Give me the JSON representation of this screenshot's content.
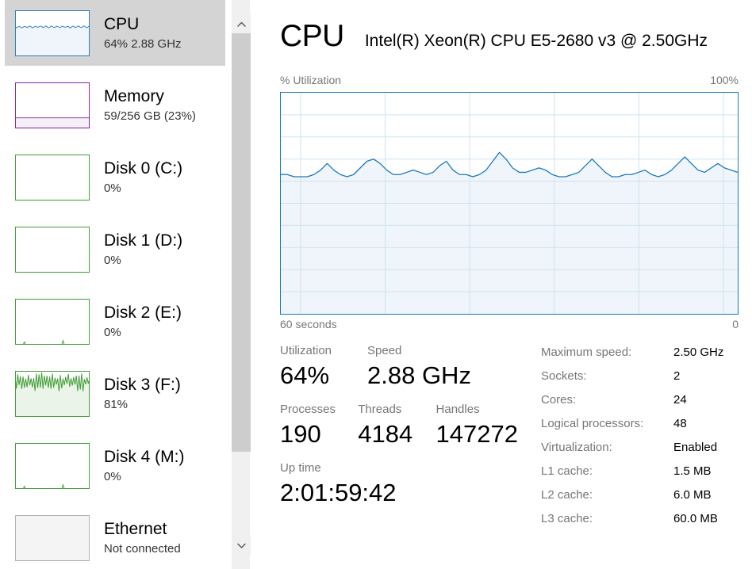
{
  "sidebar": {
    "items": [
      {
        "name": "CPU",
        "title": "CPU",
        "subtitle": "64%  2.88 GHz",
        "selected": true,
        "color": "#2a7ab5",
        "fill": "#eff5fa",
        "level": 64,
        "graph_style": "wavy"
      },
      {
        "name": "Memory",
        "title": "Memory",
        "subtitle": "59/256 GB (23%)",
        "selected": false,
        "color": "#8b1fa9",
        "fill": "#f5eff7",
        "level": 23,
        "graph_style": "flat"
      },
      {
        "name": "Disk 0 (C:)",
        "title": "Disk 0 (C:)",
        "subtitle": "0%",
        "selected": false,
        "color": "#3f9c35",
        "fill": "#eef6ed",
        "level": 1,
        "graph_style": "idle"
      },
      {
        "name": "Disk 1 (D:)",
        "title": "Disk 1 (D:)",
        "subtitle": "0%",
        "selected": false,
        "color": "#3f9c35",
        "fill": "#eef6ed",
        "level": 1,
        "graph_style": "idle"
      },
      {
        "name": "Disk 2 (E:)",
        "title": "Disk 2 (E:)",
        "subtitle": "0%",
        "selected": false,
        "color": "#3f9c35",
        "fill": "#eef6ed",
        "level": 0,
        "graph_style": "idle"
      },
      {
        "name": "Disk 3 (F:)",
        "title": "Disk 3 (F:)",
        "subtitle": "81%",
        "selected": false,
        "color": "#3f9c35",
        "fill": "#eaf4e8",
        "level": 81,
        "graph_style": "noisy"
      },
      {
        "name": "Disk 4 (M:)",
        "title": "Disk 4 (M:)",
        "subtitle": "0%",
        "selected": false,
        "color": "#3f9c35",
        "fill": "#eef6ed",
        "level": 0,
        "graph_style": "idle"
      },
      {
        "name": "Ethernet",
        "title": "Ethernet",
        "subtitle": "Not connected",
        "selected": false,
        "color": "#b0b0b0",
        "fill": "#f4f4f4",
        "level": 0,
        "graph_style": "disabled"
      }
    ]
  },
  "scrollbar": {
    "up_arrow": "chevron-up-icon",
    "down_arrow": "chevron-down-icon"
  },
  "header": {
    "title": "CPU",
    "model": "Intel(R) Xeon(R) CPU E5-2680 v3 @ 2.50GHz"
  },
  "graph": {
    "axis_top_left": "% Utilization",
    "axis_top_right": "100%",
    "axis_bottom_left": "60 seconds",
    "axis_bottom_right": "0",
    "line_color": "#1a7aba",
    "fill_color": "#eff5fa",
    "grid_color": "#cfe3f0",
    "border_color": "#157ab5"
  },
  "chart_data": {
    "type": "area",
    "title": "% Utilization",
    "xlabel": "60 seconds",
    "ylabel": "% Utilization",
    "ylim": [
      0,
      100
    ],
    "xlim": [
      60,
      0
    ],
    "grid": true,
    "grid_rows": 10,
    "grid_cols": 6,
    "series": [
      {
        "name": "CPU utilization",
        "values": [
          63,
          63,
          62,
          62,
          62,
          63,
          65,
          68,
          65,
          63,
          62,
          63,
          66,
          69,
          70,
          68,
          65,
          63,
          63,
          64,
          65,
          64,
          63,
          64,
          67,
          69,
          65,
          63,
          63,
          62,
          63,
          65,
          69,
          73,
          70,
          66,
          64,
          64,
          65,
          66,
          65,
          63,
          62,
          62,
          63,
          64,
          67,
          70,
          67,
          64,
          62,
          62,
          63,
          63,
          64,
          65,
          63,
          62,
          63,
          65,
          68,
          71,
          68,
          65,
          64,
          66,
          68,
          66,
          65,
          64
        ]
      }
    ]
  },
  "stats": {
    "utilization": {
      "label": "Utilization",
      "value": "64%"
    },
    "speed": {
      "label": "Speed",
      "value": "2.88 GHz"
    },
    "processes": {
      "label": "Processes",
      "value": "190"
    },
    "threads": {
      "label": "Threads",
      "value": "4184"
    },
    "handles": {
      "label": "Handles",
      "value": "147272"
    },
    "uptime": {
      "label": "Up time",
      "value": "2:01:59:42"
    }
  },
  "specs": [
    {
      "key": "Maximum speed:",
      "value": "2.50 GHz"
    },
    {
      "key": "Sockets:",
      "value": "2"
    },
    {
      "key": "Cores:",
      "value": "24"
    },
    {
      "key": "Logical processors:",
      "value": "48"
    },
    {
      "key": "Virtualization:",
      "value": "Enabled"
    },
    {
      "key": "L1 cache:",
      "value": "1.5 MB"
    },
    {
      "key": "L2 cache:",
      "value": "6.0 MB"
    },
    {
      "key": "L3 cache:",
      "value": "60.0 MB"
    }
  ]
}
